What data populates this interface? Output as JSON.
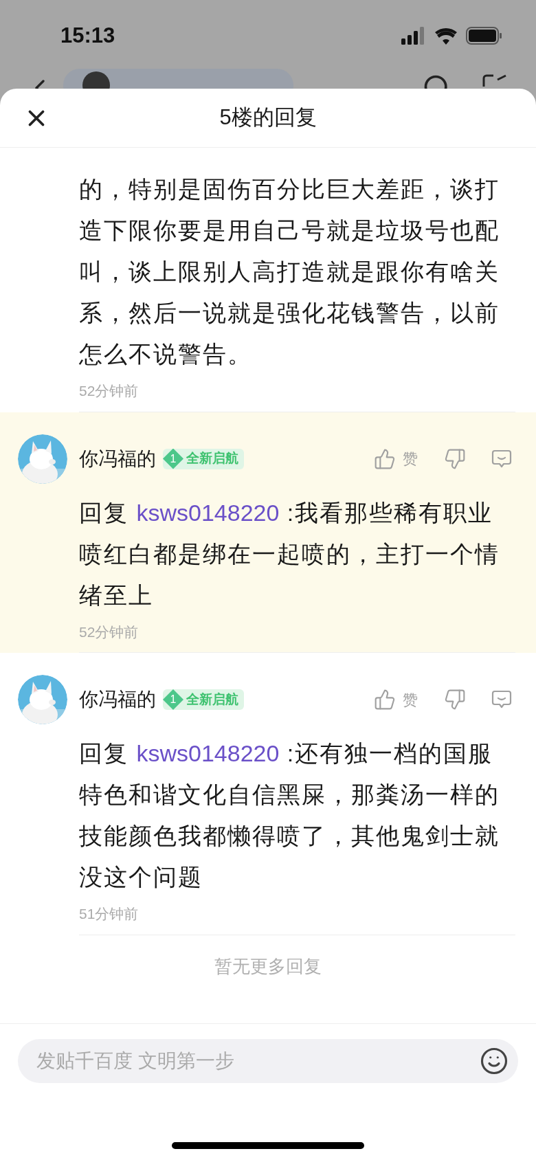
{
  "status_bar": {
    "time": "15:13"
  },
  "sheet": {
    "title": "5楼的回复"
  },
  "comments": [
    {
      "kind": "continued",
      "highlighted": false,
      "text_lines": [
        "的，特别是固伤百分比巨大差距，谈打",
        "造下限你要是用自己号就是垃圾号也配",
        "叫，谈上限别人高打造就是跟你有啥关",
        "系，然后一说就是强化花钱警告，以前",
        "怎么不说警告。"
      ],
      "time": "52分钟前"
    },
    {
      "kind": "reply",
      "highlighted": true,
      "author": "你冯福的",
      "badge_level": "1",
      "badge_label": "全新启航",
      "like_label": "赞",
      "reply_prefix": "回复",
      "reply_user": "ksws0148220",
      "text_lines": [
        ":我看那些稀有职业",
        "喷红白都是绑在一起喷的，主打一个情",
        "绪至上"
      ],
      "time": "52分钟前"
    },
    {
      "kind": "reply",
      "highlighted": false,
      "author": "你冯福的",
      "badge_level": "1",
      "badge_label": "全新启航",
      "like_label": "赞",
      "reply_prefix": "回复",
      "reply_user": "ksws0148220",
      "text_lines": [
        ":还有独一档的国服",
        "特色和谐文化自信黑屎，那粪汤一样的",
        "技能颜色我都懒得喷了，其他鬼剑士就",
        "没这个问题"
      ],
      "time": "51分钟前"
    }
  ],
  "end_note": "暂无更多回复",
  "composer": {
    "placeholder": "发贴千百度 文明第一步"
  }
}
